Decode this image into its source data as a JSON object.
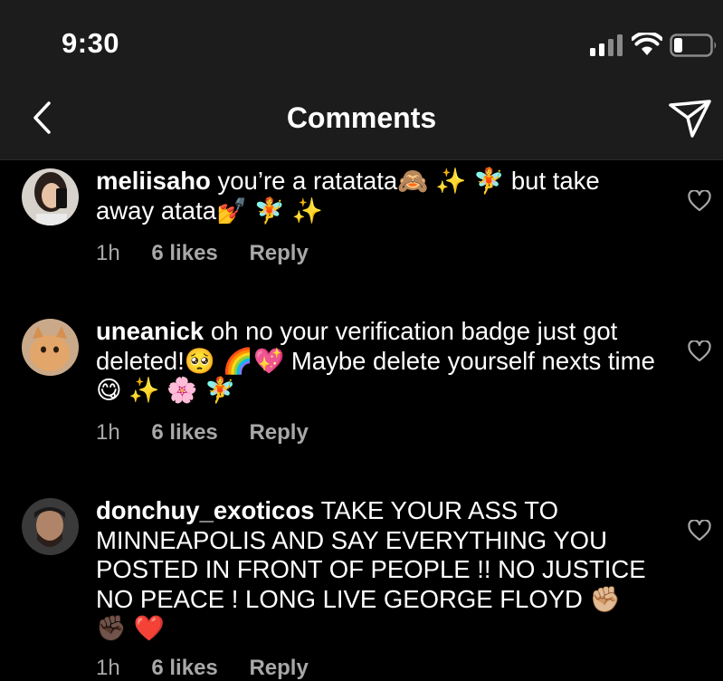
{
  "status_bar": {
    "time": "9:30"
  },
  "nav": {
    "title": "Comments"
  },
  "comments": [
    {
      "username": "meliisaho",
      "text": "you’re a ratatata🙈 ✨ 🧚 but take away atata💅 🧚 ✨",
      "age": "1h",
      "likes": "6 likes",
      "reply": "Reply"
    },
    {
      "username": "uneanick",
      "text": "oh no your verification badge just got deleted!🥺 🌈💖 Maybe delete yourself nexts time 😋 ✨ 🌸 🧚",
      "age": "1h",
      "likes": "6 likes",
      "reply": "Reply"
    },
    {
      "username": "donchuy_exoticos",
      "text": "TAKE YOUR ASS TO MINNEAPOLIS AND SAY EVERYTHING YOU POSTED IN FRONT OF PEOPLE !! NO JUSTICE NO PEACE ! LONG LIVE GEORGE FLOYD ✊🏼 ✊🏿 ❤️",
      "age": "1h",
      "likes": "6 likes",
      "reply": "Reply"
    }
  ]
}
